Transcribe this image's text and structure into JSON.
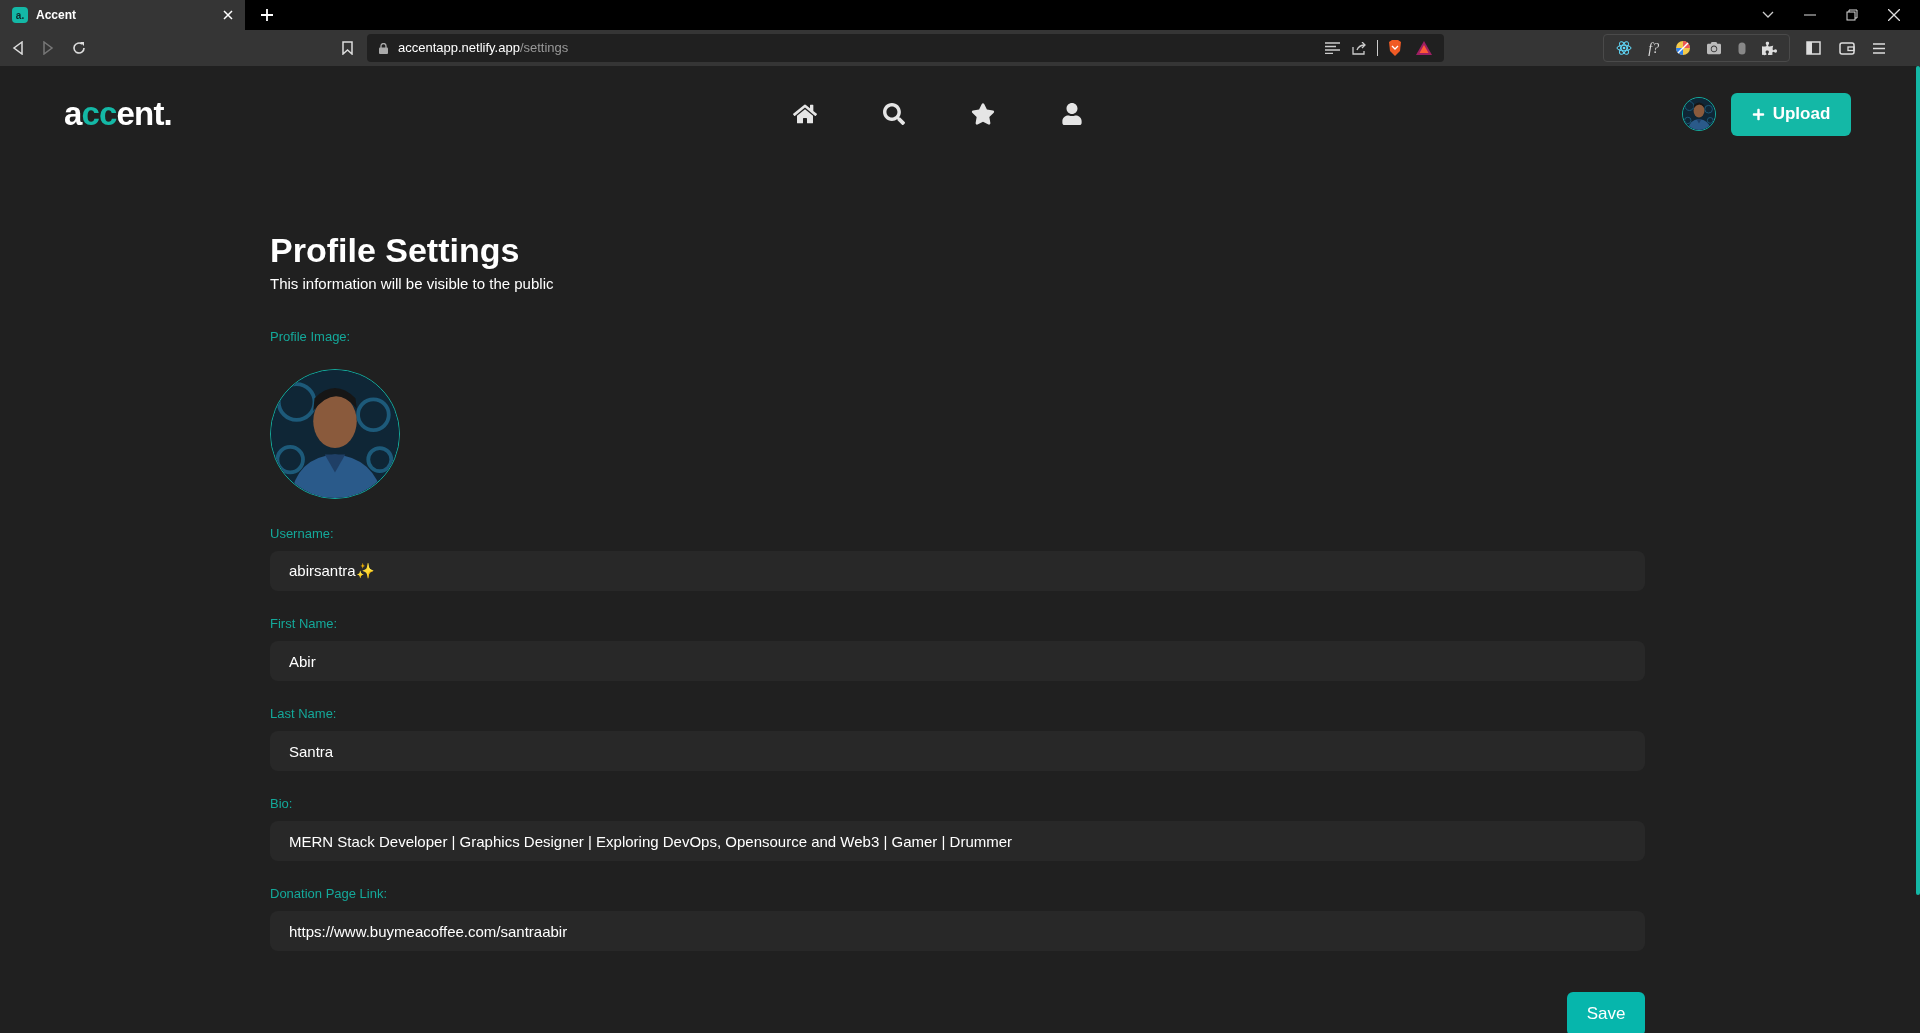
{
  "browser": {
    "tab": {
      "favicon": "a.",
      "title": "Accent"
    },
    "url": {
      "host": "accentapp.netlify.app",
      "path": "/settings"
    },
    "extension_text": "f?"
  },
  "header": {
    "logo": [
      {
        "text": "a",
        "accent": false
      },
      {
        "text": "cc",
        "accent": true
      },
      {
        "text": "ent.",
        "accent": false
      }
    ],
    "upload_button": "Upload"
  },
  "page": {
    "title": "Profile Settings",
    "subtitle": "This information will be visible to the public",
    "profile_image_label": "Profile Image:",
    "fields": [
      {
        "label": "Username:",
        "value": "abirsantra✨"
      },
      {
        "label": "First Name:",
        "value": "Abir"
      },
      {
        "label": "Last Name:",
        "value": "Santra"
      },
      {
        "label": "Bio:",
        "value": "MERN Stack Developer | Graphics Designer | Exploring DevOps, Opensource and Web3 | Gamer | Drummer"
      },
      {
        "label": "Donation Page Link:",
        "value": "https://www.buymeacoffee.com/santraabir"
      }
    ],
    "save_button": "Save"
  }
}
